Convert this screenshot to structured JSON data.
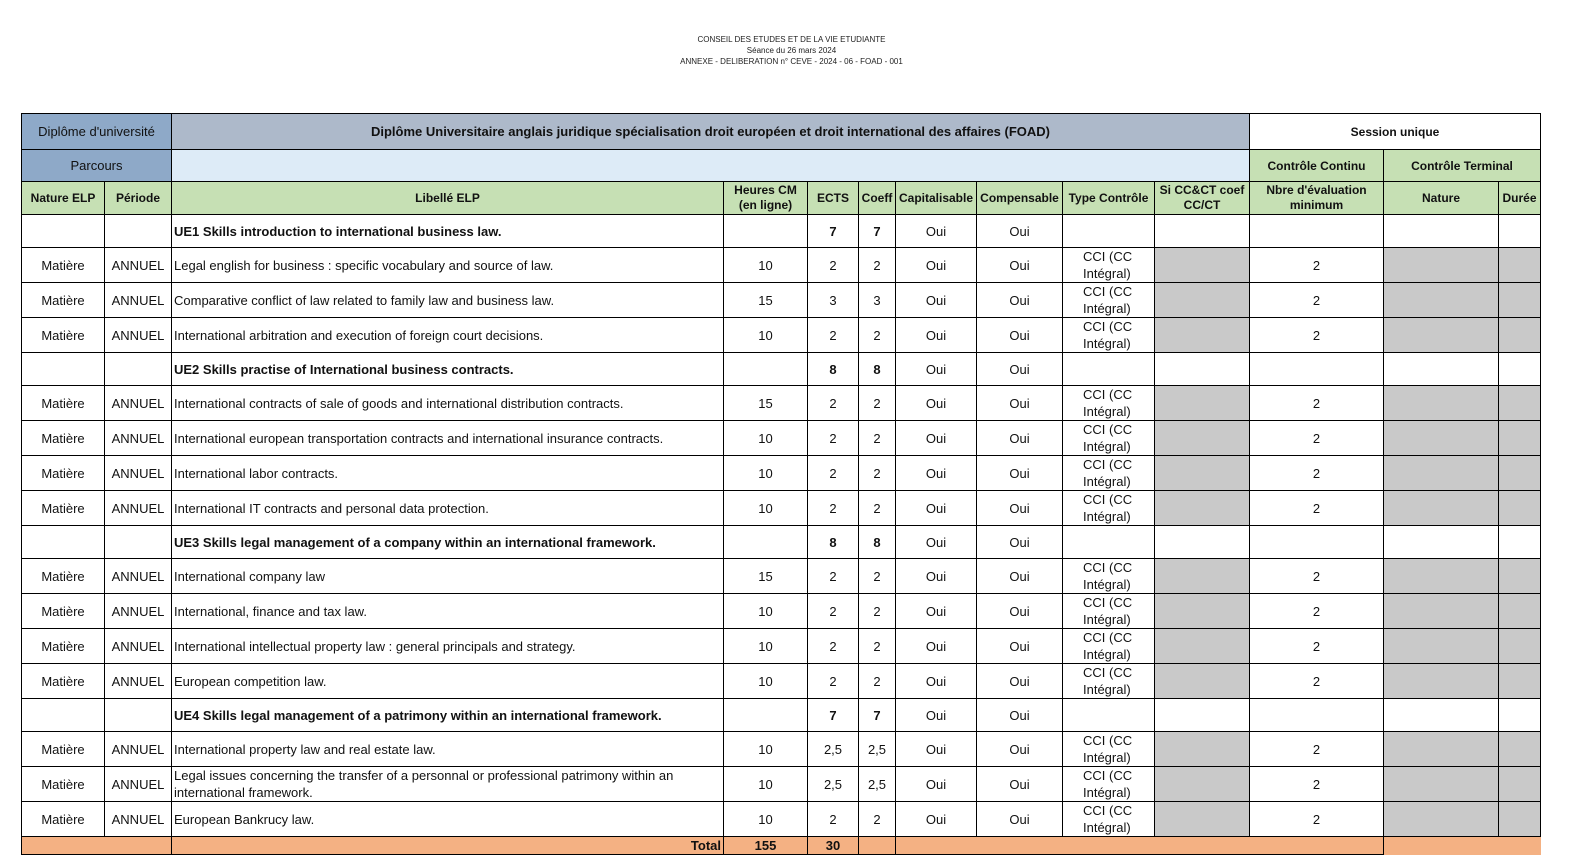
{
  "header": {
    "line1": "CONSEIL DES ETUDES ET DE LA VIE ETUDIANTE",
    "line2": "Séance du 26 mars 2024",
    "line3": "ANNEXE - DELIBERATION n° CEVE - 2024 - 06 - FOAD - 001"
  },
  "table": {
    "diplome_label": "Diplôme d'université",
    "diplome_title": "Diplôme Universitaire anglais juridique spécialisation droit européen et droit international des affaires (FOAD)",
    "session": "Session unique",
    "parcours_label": "Parcours",
    "controle_continu": "Contrôle Continu",
    "controle_terminal": "Contrôle Terminal",
    "columns": {
      "nature_elp": "Nature ELP",
      "periode": "Période",
      "libelle_elp": "Libellé ELP",
      "heures_cm": "Heures CM (en ligne)",
      "ects": "ECTS",
      "coeff": "Coeff",
      "capitalisable": "Capitalisable",
      "compensable": "Compensable",
      "type_controle": "Type  Contrôle",
      "si_cc_ct": "Si CC&CT coef CC/CT",
      "nbre_eval": "Nbre d'évaluation minimum",
      "nature": "Nature",
      "duree": "Durée"
    },
    "rows": [
      {
        "kind": "ue",
        "nature": "",
        "periode": "",
        "libelle": "UE1 Skills introduction to international business law.",
        "heures": "",
        "ects": "7",
        "coeff": "7",
        "cap": "Oui",
        "comp": "Oui",
        "type": "",
        "nbre": ""
      },
      {
        "kind": "m",
        "nature": "Matière",
        "periode": "ANNUEL",
        "libelle": "Legal english for business : specific vocabulary and source of law.",
        "heures": "10",
        "ects": "2",
        "coeff": "2",
        "cap": "Oui",
        "comp": "Oui",
        "type": "CCI (CC Intégral)",
        "nbre": "2"
      },
      {
        "kind": "m",
        "nature": "Matière",
        "periode": "ANNUEL",
        "libelle": "Comparative conflict of law related to family law and business law.",
        "heures": "15",
        "ects": "3",
        "coeff": "3",
        "cap": "Oui",
        "comp": "Oui",
        "type": "CCI (CC Intégral)",
        "nbre": "2"
      },
      {
        "kind": "m",
        "nature": "Matière",
        "periode": "ANNUEL",
        "libelle": "International arbitration and execution of foreign court decisions.",
        "heures": "10",
        "ects": "2",
        "coeff": "2",
        "cap": "Oui",
        "comp": "Oui",
        "type": "CCI (CC Intégral)",
        "nbre": "2"
      },
      {
        "kind": "ue",
        "nature": "",
        "periode": "",
        "libelle": "UE2 Skills practise of International business contracts.",
        "heures": "",
        "ects": "8",
        "coeff": "8",
        "cap": "Oui",
        "comp": "Oui",
        "type": "",
        "nbre": ""
      },
      {
        "kind": "m",
        "nature": "Matière",
        "periode": "ANNUEL",
        "libelle": "International contracts of sale of goods and international distribution contracts.",
        "heures": "15",
        "ects": "2",
        "coeff": "2",
        "cap": "Oui",
        "comp": "Oui",
        "type": "CCI (CC Intégral)",
        "nbre": "2"
      },
      {
        "kind": "m",
        "nature": "Matière",
        "periode": "ANNUEL",
        "libelle": "International european transportation contracts and international insurance contracts.",
        "heures": "10",
        "ects": "2",
        "coeff": "2",
        "cap": "Oui",
        "comp": "Oui",
        "type": "CCI (CC Intégral)",
        "nbre": "2"
      },
      {
        "kind": "m",
        "nature": "Matière",
        "periode": "ANNUEL",
        "libelle": "International labor contracts.",
        "heures": "10",
        "ects": "2",
        "coeff": "2",
        "cap": "Oui",
        "comp": "Oui",
        "type": "CCI (CC Intégral)",
        "nbre": "2"
      },
      {
        "kind": "m",
        "nature": "Matière",
        "periode": "ANNUEL",
        "libelle": "International IT contracts and personal data protection.",
        "heures": "10",
        "ects": "2",
        "coeff": "2",
        "cap": "Oui",
        "comp": "Oui",
        "type": "CCI (CC Intégral)",
        "nbre": "2"
      },
      {
        "kind": "ue",
        "nature": "",
        "periode": "",
        "libelle": "UE3 Skills legal management of a company within an international framework.",
        "heures": "",
        "ects": "8",
        "coeff": "8",
        "cap": "Oui",
        "comp": "Oui",
        "type": "",
        "nbre": ""
      },
      {
        "kind": "m",
        "nature": "Matière",
        "periode": "ANNUEL",
        "libelle": "International company law",
        "heures": "15",
        "ects": "2",
        "coeff": "2",
        "cap": "Oui",
        "comp": "Oui",
        "type": "CCI (CC Intégral)",
        "nbre": "2"
      },
      {
        "kind": "m",
        "nature": "Matière",
        "periode": "ANNUEL",
        "libelle": "International, finance and tax law.",
        "heures": "10",
        "ects": "2",
        "coeff": "2",
        "cap": "Oui",
        "comp": "Oui",
        "type": "CCI (CC Intégral)",
        "nbre": "2"
      },
      {
        "kind": "m",
        "nature": "Matière",
        "periode": "ANNUEL",
        "libelle": "International intellectual property law : general principals and strategy.",
        "heures": "10",
        "ects": "2",
        "coeff": "2",
        "cap": "Oui",
        "comp": "Oui",
        "type": "CCI (CC Intégral)",
        "nbre": "2"
      },
      {
        "kind": "m",
        "nature": "Matière",
        "periode": "ANNUEL",
        "libelle": "European competition law.",
        "heures": "10",
        "ects": "2",
        "coeff": "2",
        "cap": "Oui",
        "comp": "Oui",
        "type": "CCI (CC Intégral)",
        "nbre": "2"
      },
      {
        "kind": "ue",
        "nature": "",
        "periode": "",
        "libelle": "UE4 Skills legal management of a patrimony within an international framework.",
        "heures": "",
        "ects": "7",
        "coeff": "7",
        "cap": "Oui",
        "comp": "Oui",
        "type": "",
        "nbre": ""
      },
      {
        "kind": "m",
        "nature": "Matière",
        "periode": "ANNUEL",
        "libelle": "International property law and real estate law.",
        "heures": "10",
        "ects": "2,5",
        "coeff": "2,5",
        "cap": "Oui",
        "comp": "Oui",
        "type": "CCI (CC Intégral)",
        "nbre": "2"
      },
      {
        "kind": "m",
        "nature": "Matière",
        "periode": "ANNUEL",
        "libelle": "Legal issues concerning the transfer of a personnal or professional patrimony within an international framework.",
        "heures": "10",
        "ects": "2,5",
        "coeff": "2,5",
        "cap": "Oui",
        "comp": "Oui",
        "type": "CCI (CC Intégral)",
        "nbre": "2"
      },
      {
        "kind": "m",
        "nature": "Matière",
        "periode": "ANNUEL",
        "libelle": "European Bankrucy law.",
        "heures": "10",
        "ects": "2",
        "coeff": "2",
        "cap": "Oui",
        "comp": "Oui",
        "type": "CCI (CC Intégral)",
        "nbre": "2"
      }
    ],
    "total": {
      "label": "Total",
      "heures": "155",
      "ects": "30"
    }
  }
}
